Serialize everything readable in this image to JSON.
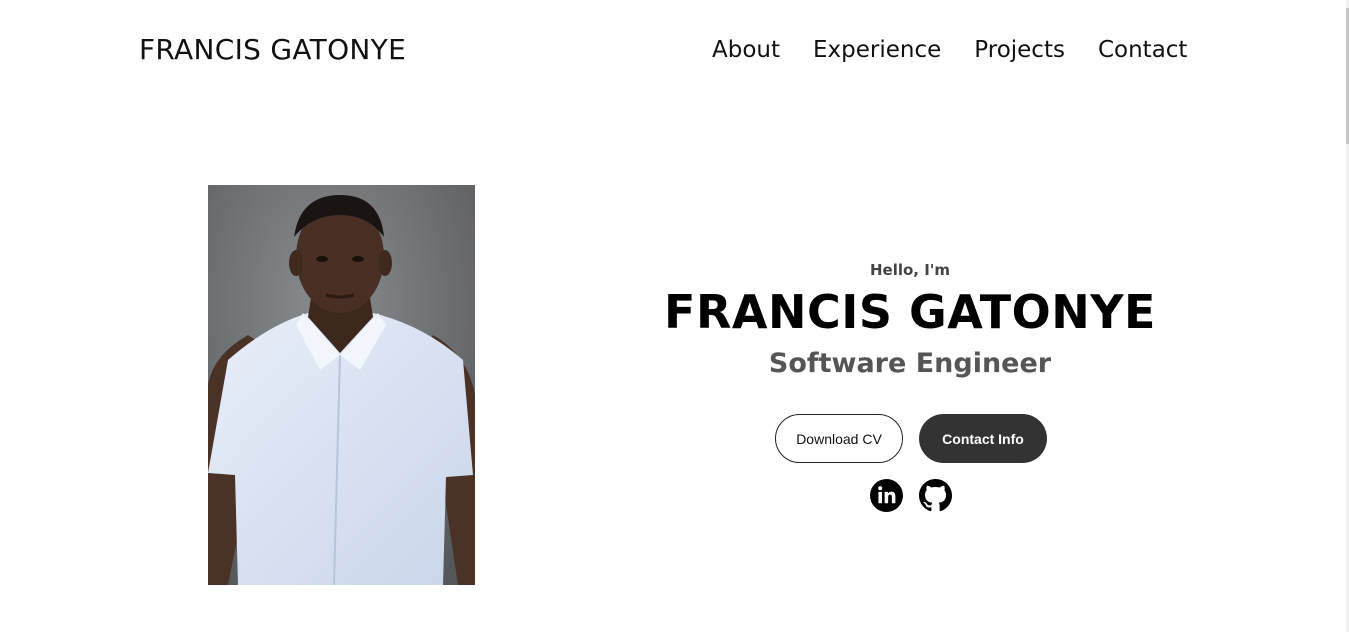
{
  "nav": {
    "logo": "FRANCIS GATONYE",
    "links": [
      "About",
      "Experience",
      "Projects",
      "Contact"
    ]
  },
  "hero": {
    "greeting": "Hello, I'm",
    "name": "FRANCIS GATONYE",
    "title": "Software Engineer",
    "buttons": {
      "download_cv": "Download CV",
      "contact_info": "Contact Info"
    },
    "socials": [
      "linkedin-icon",
      "github-icon"
    ]
  },
  "colors": {
    "background": "#ffffff",
    "text": "#111111",
    "subtitle": "#555555",
    "dark_button": "#333333"
  }
}
